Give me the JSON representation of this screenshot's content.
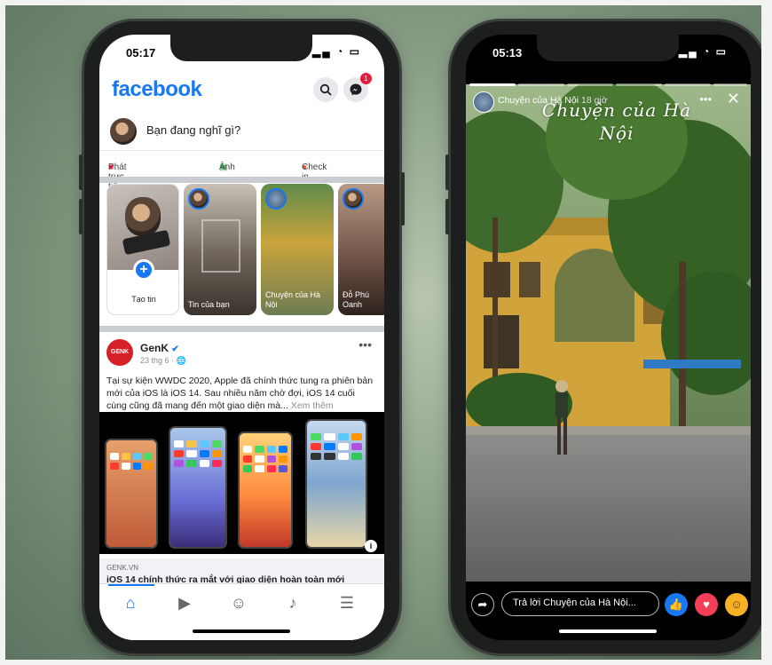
{
  "left_phone": {
    "status_time": "05:17",
    "app_logo": "facebook",
    "messenger_badge": "1",
    "composer_placeholder": "Bạn đang nghĩ gì?",
    "actions": [
      "Phát trực tiếp",
      "Ảnh",
      "Check in"
    ],
    "stories": [
      {
        "label": "Tạo tin"
      },
      {
        "label": "Tin của bạn"
      },
      {
        "label": "Chuyện của Hà Nội"
      },
      {
        "label": "Đỗ Phú Oanh"
      }
    ],
    "post": {
      "author": "GenK",
      "author_logo_text": "GENK",
      "meta": "23 thg 6 · 🌐",
      "body": "Tại sự kiện WWDC 2020, Apple đã chính thức tung ra phiên bản mới của iOS là iOS 14. Sau nhiều năm chờ đợi, iOS 14 cuối cùng cũng đã mang đến một giao diện mà...",
      "see_more": "Xem thêm",
      "link_source": "GENK.VN",
      "link_title": "iOS 14 chính thức ra mắt với giao diện hoàn toàn mới"
    },
    "tabs": [
      "home-icon",
      "watch-icon",
      "profile-icon",
      "bell-icon",
      "menu-icon"
    ],
    "accent": "#1877f2"
  },
  "right_phone": {
    "status_time": "05:13",
    "story_name": "Chuyện của Hà Nội",
    "story_time": "18 giờ",
    "overlay_title": "Chuyện của Hà Nội",
    "reply_placeholder": "Trả lời Chuyện của Hà Nội...",
    "reactions": [
      "like",
      "love",
      "haha"
    ]
  }
}
